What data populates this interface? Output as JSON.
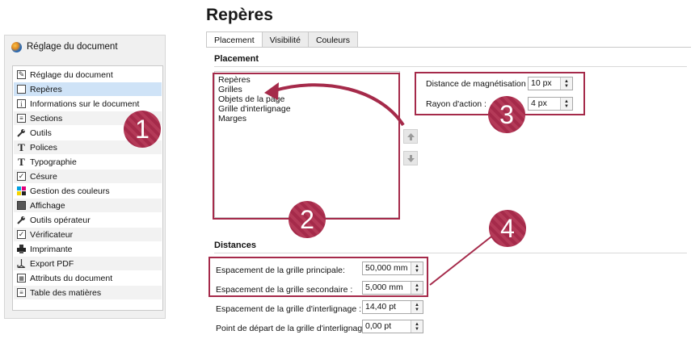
{
  "left_panel": {
    "title": "Réglage du document",
    "items": [
      {
        "label": "Réglage du document",
        "icon": "document-settings-icon"
      },
      {
        "label": "Repères",
        "icon": "guides-icon"
      },
      {
        "label": "Informations sur le document",
        "icon": "info-icon"
      },
      {
        "label": "Sections",
        "icon": "sections-icon"
      },
      {
        "label": "Outils",
        "icon": "wrench-icon"
      },
      {
        "label": "Polices",
        "icon": "font-icon"
      },
      {
        "label": "Typographie",
        "icon": "typography-icon"
      },
      {
        "label": "Césure",
        "icon": "hyphenation-checkbox-icon"
      },
      {
        "label": "Gestion des couleurs",
        "icon": "color-management-icon"
      },
      {
        "label": "Affichage",
        "icon": "display-icon"
      },
      {
        "label": "Outils opérateur",
        "icon": "operator-tools-icon"
      },
      {
        "label": "Vérificateur",
        "icon": "preflight-checkbox-icon"
      },
      {
        "label": "Imprimante",
        "icon": "printer-icon"
      },
      {
        "label": "Export PDF",
        "icon": "pdf-export-icon"
      },
      {
        "label": "Attributs du document",
        "icon": "attributes-icon"
      },
      {
        "label": "Table des matières",
        "icon": "toc-icon"
      }
    ],
    "selected": "Repères"
  },
  "main": {
    "title": "Repères",
    "tabs": [
      "Placement",
      "Visibilité",
      "Couleurs"
    ],
    "active_tab": "Placement",
    "placement": {
      "heading": "Placement",
      "list": [
        "Repères",
        "Grilles",
        "Objets de la page",
        "Grille d'interlignage",
        "Marges"
      ],
      "snap_distance_label": "Distance de magnétisation :",
      "snap_distance_value": "10 px",
      "grab_radius_label": "Rayon d'action :",
      "grab_radius_value": "4 px"
    },
    "distances": {
      "heading": "Distances",
      "fields": [
        {
          "label": "Espacement de la grille principale:",
          "value": "50,000 mm"
        },
        {
          "label": "Espacement de la grille secondaire :",
          "value": "5,000 mm"
        },
        {
          "label": "Espacement de la grille d'interlignage :",
          "value": "14,40 pt"
        },
        {
          "label": "Point de départ de la grille d'interlignage :",
          "value": "0,00 pt"
        }
      ]
    }
  },
  "callouts": [
    "1",
    "2",
    "3",
    "4"
  ],
  "colors": {
    "accent": "#a52a4a",
    "selection": "#cfe3f7"
  }
}
